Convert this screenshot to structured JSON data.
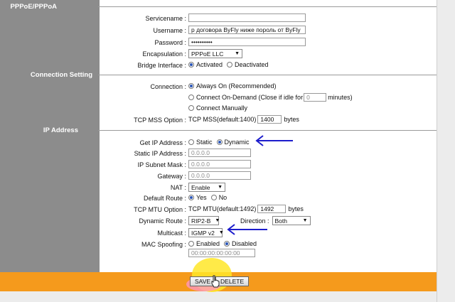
{
  "sections": {
    "pppoe": "PPPoE/PPPoA",
    "connection": "Connection Setting",
    "ip": "IP Address"
  },
  "pppoe": {
    "servicename": {
      "label": "Servicename :",
      "value": ""
    },
    "username": {
      "label": "Username :",
      "value": "р договора ByFly ниже пороль от ByFly"
    },
    "password": {
      "label": "Password :",
      "value": "••••••••••"
    },
    "encapsulation": {
      "label": "Encapsulation :",
      "value": "PPPoE LLC"
    },
    "bridge": {
      "label": "Bridge Interface :",
      "opt1": "Activated",
      "opt2": "Deactivated"
    }
  },
  "connection": {
    "label": "Connection :",
    "always_on": "Always On (Recommended)",
    "on_demand": "Connect On-Demand (Close if idle for",
    "idle_value": "0",
    "minutes": "minutes)",
    "manual": "Connect Manually",
    "tcp_mss_label": "TCP MSS Option :",
    "tcp_mss_text": "TCP MSS(default:1400)",
    "tcp_mss_value": "1400",
    "bytes": "bytes"
  },
  "ip": {
    "get_ip_label": "Get IP Address :",
    "static": "Static",
    "dynamic": "Dynamic",
    "static_ip_label": "Static IP Address :",
    "static_ip_value": "0.0.0.0",
    "subnet_label": "IP Subnet Mask :",
    "subnet_value": "0.0.0.0",
    "gateway_label": "Gateway :",
    "gateway_value": "0.0.0.0",
    "nat_label": "NAT :",
    "nat_value": "Enable",
    "default_route_label": "Default Route :",
    "yes": "Yes",
    "no": "No",
    "tcp_mtu_label": "TCP MTU Option :",
    "tcp_mtu_text": "TCP MTU(default:1492)",
    "tcp_mtu_value": "1492",
    "bytes": "bytes",
    "dynamic_route_label": "Dynamic Route :",
    "dynamic_route_value": "RIP2-B",
    "direction_label": "Direction :",
    "direction_value": "Both",
    "multicast_label": "Multicast :",
    "multicast_value": "IGMP v2",
    "mac_label": "MAC Spoofing :",
    "enabled": "Enabled",
    "disabled": "Disabled",
    "mac_value": "00:00:00:00:00:00"
  },
  "buttons": {
    "save": "SAVE",
    "delete": "DELETE"
  },
  "colors": {
    "sidebar": "#8c8c8c",
    "footer": "#f59a1c",
    "arrow": "#1c1ccc",
    "radio": "#2a56b8"
  }
}
